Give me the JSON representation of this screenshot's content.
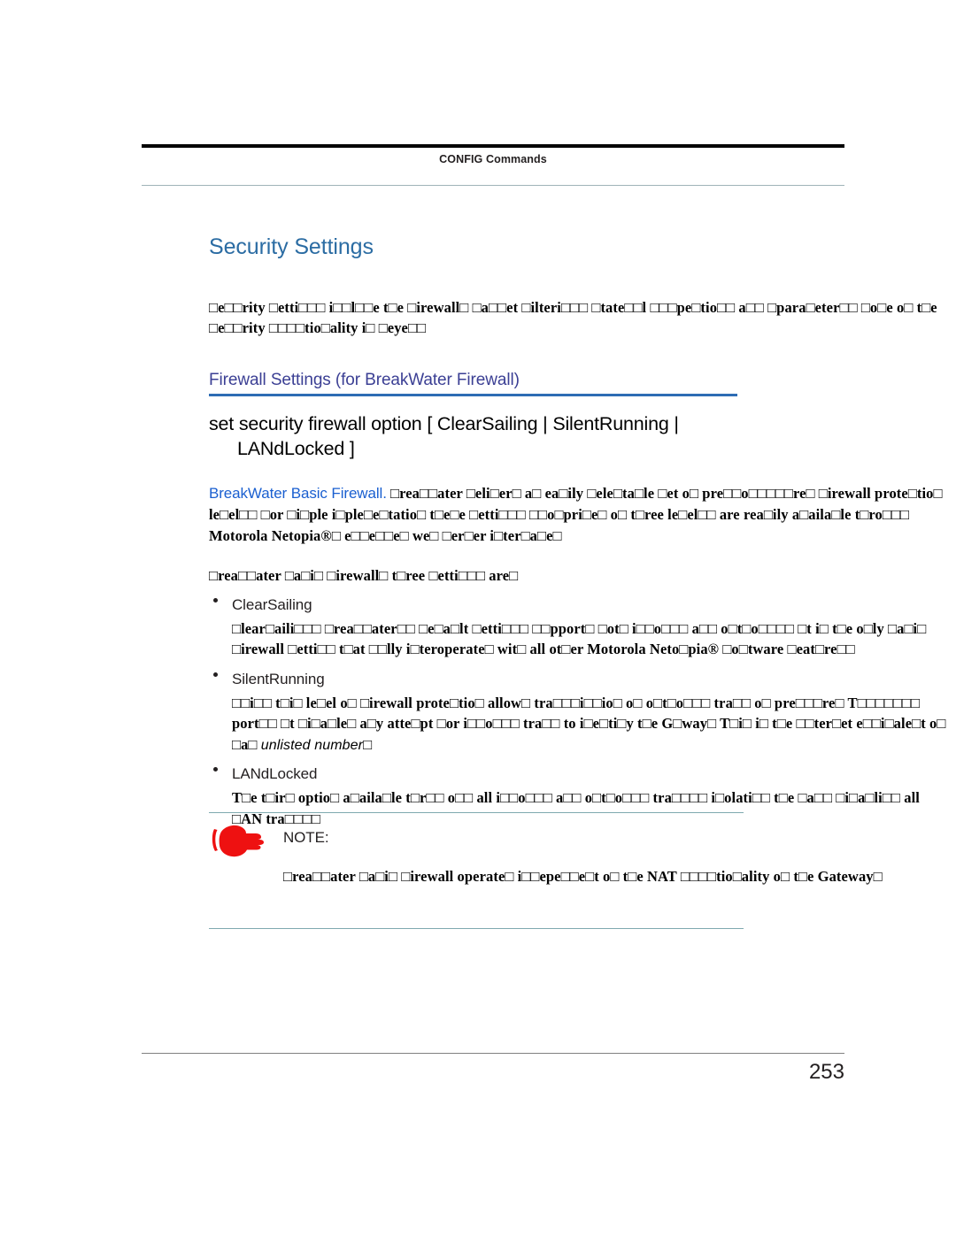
{
  "header": {
    "running_head": "CONFIG Commands"
  },
  "section": {
    "title": "Security Settings",
    "title_color": "#2b6ca3",
    "intro_paragraph": "□e□□rity □etti□□□ i□□l□□e t□e □irewall□ □a□□et □ilteri□□□ □tate□□l □□□pe□tio□□ a□□ □para□eter□□ □o□e o□ t□e □e□□rity □□□□tio□ality i□ □eye□□"
  },
  "subsection": {
    "title": "Firewall Settings (for BreakWater Firewall)",
    "title_color": "#3b3f94",
    "rule_color": "#2e6db4"
  },
  "command": {
    "line1": "set security firewall option [ ClearSailing | SilentRunning |",
    "line2": "LANdLocked ]"
  },
  "runin": {
    "label": "BreakWater Basic Firewall.",
    "label_color": "#1a5fd0",
    "text": " □rea□□ater □eli□er□ a□ ea□ily □ele□ta□le □et o□ pre□□o□□□□□re□ □irewall prote□tio□ le□el□□ □or □i□ple i□ple□e□tatio□ t□e□e □etti□□□ □□o□pri□e□ o□ t□ree le□el□□ are rea□ily a□aila□le t□ro□□□ Motorola Netopia®□ e□□e□□e□ we□ □er□er i□ter□a□e□"
  },
  "lead": {
    "text": "□rea□□ater □a□i□ □irewall□ t□ree □etti□□□ are□"
  },
  "options": [
    {
      "name": "ClearSailing",
      "description": "□lear□aili□□□ □rea□□ater□□ □e□a□lt □etti□□□ □□pport□ □ot□ i□□o□□□ a□□ o□t□o□□□□ □t i□ t□e o□ly □a□i□ □irewall □etti□□ t□at □□lly i□teroperate□ wit□ all ot□er Motorola Neto□pia® □o□tware □eat□re□□",
      "italic_run": "",
      "description_tail": ""
    },
    {
      "name": "SilentRunning",
      "description": "□□i□□ t□i□ le□el o□ □irewall prote□tio□ allow□ tra□□□i□□io□ o□ o□t□o□□□ tra□□ o□ pre□□□re□ T□□□□□□□ port□□ □t □i□a□le□ a□y atte□pt □or i□□o□□□ tra□□ to i□e□ti□y t□e G□way□ T□i□ i□ t□e □□ter□et e□□i□ale□t o□ □a□ ",
      "italic_run": "unlisted number",
      "description_tail": "□"
    },
    {
      "name": "LANdLocked",
      "description": "T□e t□ir□ optio□ a□aila□le t□r□□ o□□ all i□□o□□□ a□□ o□t□o□□□ tra□□□□ i□olati□□ t□e □a□□ □i□a□li□□ all □AN tra□□□□",
      "italic_run": "",
      "description_tail": ""
    }
  ],
  "note": {
    "icon": "pointing-hand-icon",
    "icon_color": "#ee1111",
    "label": "NOTE:",
    "text": "□rea□□ater □a□i□ □irewall operate□ i□□epe□□e□t o□ t□e NAT □□□□tio□ality o□ t□e Gateway□",
    "rule_color": "#7fa9b0"
  },
  "footer": {
    "page_number": "253"
  }
}
